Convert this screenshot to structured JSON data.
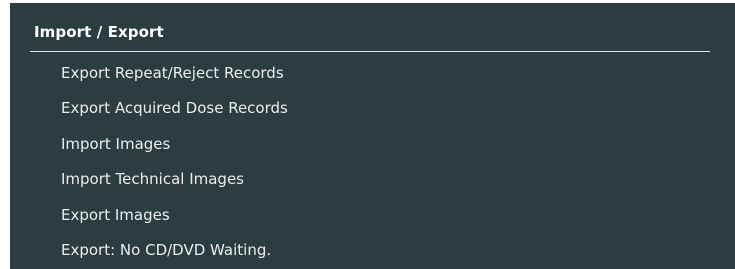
{
  "panel": {
    "title": "Import / Export",
    "items": [
      {
        "label": "Export Repeat/Reject Records"
      },
      {
        "label": "Export Acquired Dose Records"
      },
      {
        "label": "Import Images"
      },
      {
        "label": "Import Technical Images"
      },
      {
        "label": "Export Images"
      },
      {
        "label": "Export: No CD/DVD Waiting."
      }
    ]
  },
  "colors": {
    "panel_background": "#2b3d40",
    "text": "#ececec",
    "title_text": "#ffffff",
    "divider": "#dfe5e6"
  }
}
